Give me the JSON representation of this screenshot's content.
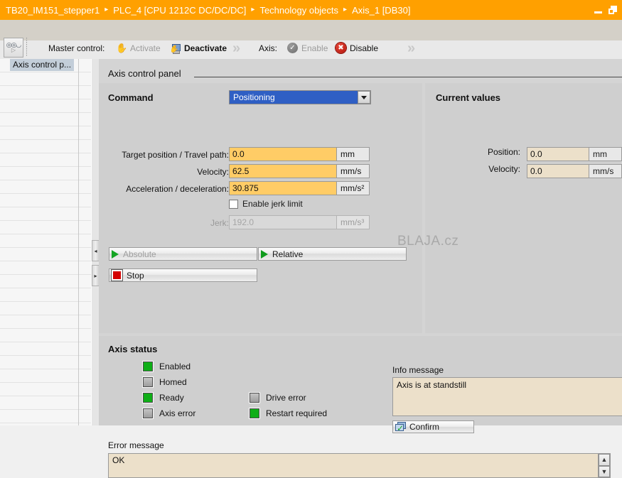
{
  "titlebar": {
    "breadcrumbs": [
      "TB20_IM151_stepper1",
      "PLC_4 [CPU 1212C DC/DC/DC]",
      "Technology objects",
      "Axis_1 [DB30]"
    ],
    "separator": "▸",
    "window_buttons": {
      "minimize": "minimize-icon",
      "restore": "restore-icon"
    },
    "background_color": "#ffa000"
  },
  "toolbar": {
    "view_button_icon": "glasses-icon",
    "master_control_label": "Master control:",
    "activate_label": "Activate",
    "activate_icon": "hand-icon",
    "activate_enabled": false,
    "deactivate_label": "Deactivate",
    "deactivate_icon": "computer-hand-icon",
    "deactivate_enabled": true,
    "chevron_icon": "double-chevron-right-icon",
    "axis_label": "Axis:",
    "enable_label": "Enable",
    "enable_icon": "circle-check-icon",
    "enable_enabled": false,
    "disable_label": "Disable",
    "disable_icon": "circle-x-icon",
    "disable_enabled": true
  },
  "sidebar": {
    "selected_item": "Axis control p...",
    "rows": 24
  },
  "main": {
    "panel_title": "Axis control panel",
    "command": {
      "heading": "Command",
      "mode_value": "Positioning",
      "fields": [
        {
          "label": "Target position / Travel path:",
          "value": "0.0",
          "unit": "mm",
          "disabled": false
        },
        {
          "label": "Velocity:",
          "value": "62.5",
          "unit": "mm/s",
          "disabled": false
        },
        {
          "label": "Acceleration / deceleration:",
          "value": "30.875",
          "unit": "mm/s²",
          "disabled": false
        }
      ],
      "jerk_checkbox_label": "Enable jerk limit",
      "jerk_checked": false,
      "jerk_field": {
        "label": "Jerk:",
        "value": "192.0",
        "unit": "mm/s³",
        "disabled": true
      },
      "buttons": [
        {
          "name": "absolute",
          "label": "Absolute",
          "icon": "play-triangle-icon",
          "enabled": false
        },
        {
          "name": "relative",
          "label": "Relative",
          "icon": "play-triangle-icon",
          "enabled": true
        },
        {
          "name": "stop",
          "label": "Stop",
          "icon": "stop-square-icon",
          "enabled": true
        }
      ]
    },
    "current_values": {
      "heading": "Current values",
      "rows": [
        {
          "label": "Position:",
          "value": "0.0",
          "unit": "mm"
        },
        {
          "label": "Velocity:",
          "value": "0.0",
          "unit": "mm/s"
        }
      ]
    },
    "axis_status": {
      "heading": "Axis status",
      "left_column": [
        {
          "label": "Enabled",
          "state": true
        },
        {
          "label": "Homed",
          "state": false
        },
        {
          "label": "Ready",
          "state": true
        },
        {
          "label": "Axis error",
          "state": false
        }
      ],
      "right_column": [
        {
          "label": "Drive error",
          "state": false
        },
        {
          "label": "Restart required",
          "state": true
        }
      ],
      "led_on_color": "#0fae17",
      "led_off_color": "#a9a9a9"
    },
    "info_message": {
      "heading": "Info message",
      "text": "Axis is at standstill",
      "confirm_label": "Confirm",
      "confirm_icon": "confirm-stack-check-icon"
    },
    "error_message": {
      "heading": "Error message",
      "text": "OK",
      "scroll_up_icon": "chevron-up-icon",
      "scroll_down_icon": "chevron-down-icon"
    }
  },
  "watermark": {
    "text": "BLAJA.cz"
  }
}
